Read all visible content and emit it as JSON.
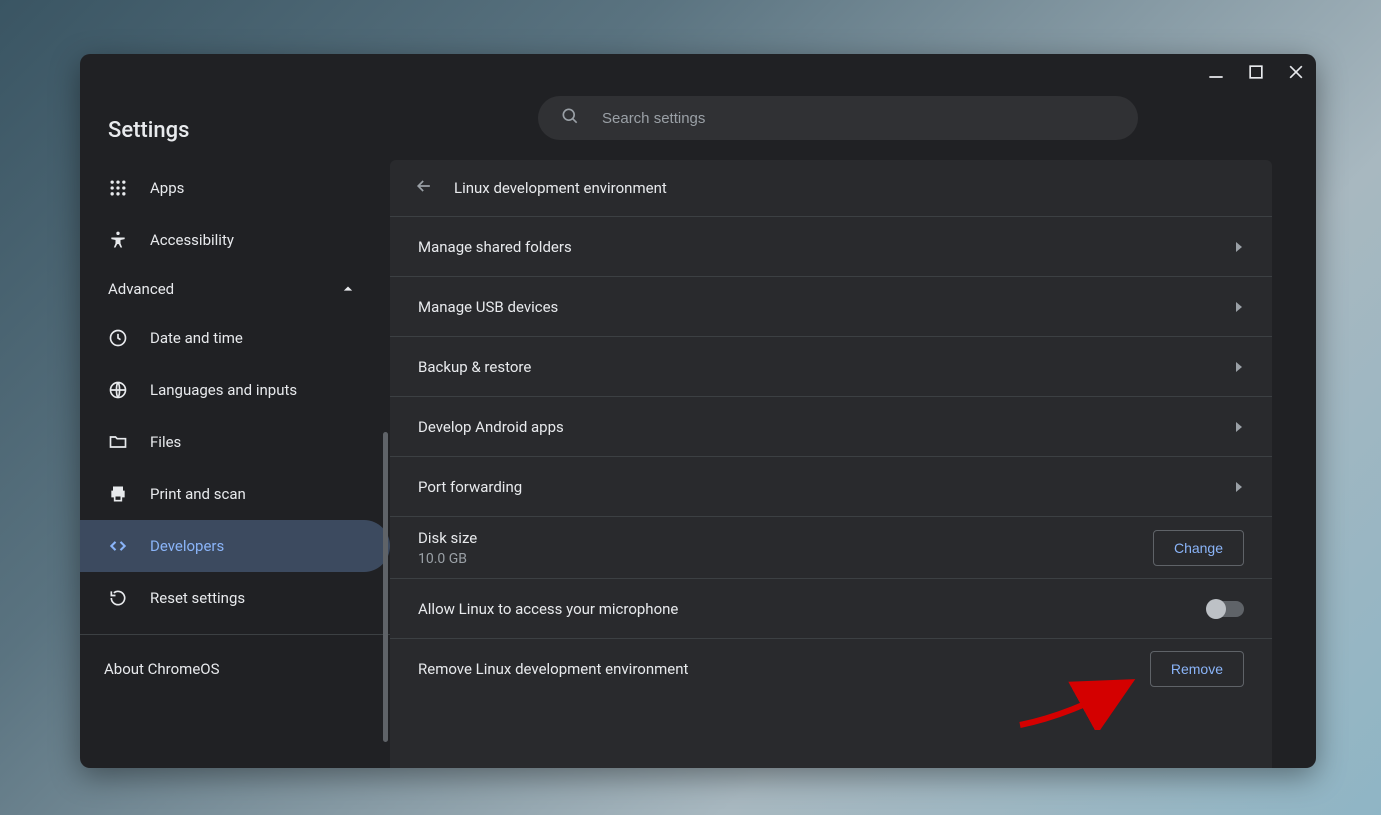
{
  "app_title": "Settings",
  "search": {
    "placeholder": "Search settings"
  },
  "sidebar": {
    "items": [
      {
        "label": "Apps"
      },
      {
        "label": "Accessibility"
      }
    ],
    "advanced_label": "Advanced",
    "adv_items": [
      {
        "label": "Date and time"
      },
      {
        "label": "Languages and inputs"
      },
      {
        "label": "Files"
      },
      {
        "label": "Print and scan"
      },
      {
        "label": "Developers"
      },
      {
        "label": "Reset settings"
      }
    ],
    "about_label": "About ChromeOS"
  },
  "page": {
    "title": "Linux development environment",
    "rows": {
      "shared": "Manage shared folders",
      "usb": "Manage USB devices",
      "backup": "Backup & restore",
      "android": "Develop Android apps",
      "port": "Port forwarding",
      "disk_label": "Disk size",
      "disk_value": "10.0 GB",
      "disk_btn": "Change",
      "mic": "Allow Linux to access your microphone",
      "remove_label": "Remove Linux development environment",
      "remove_btn": "Remove"
    }
  }
}
